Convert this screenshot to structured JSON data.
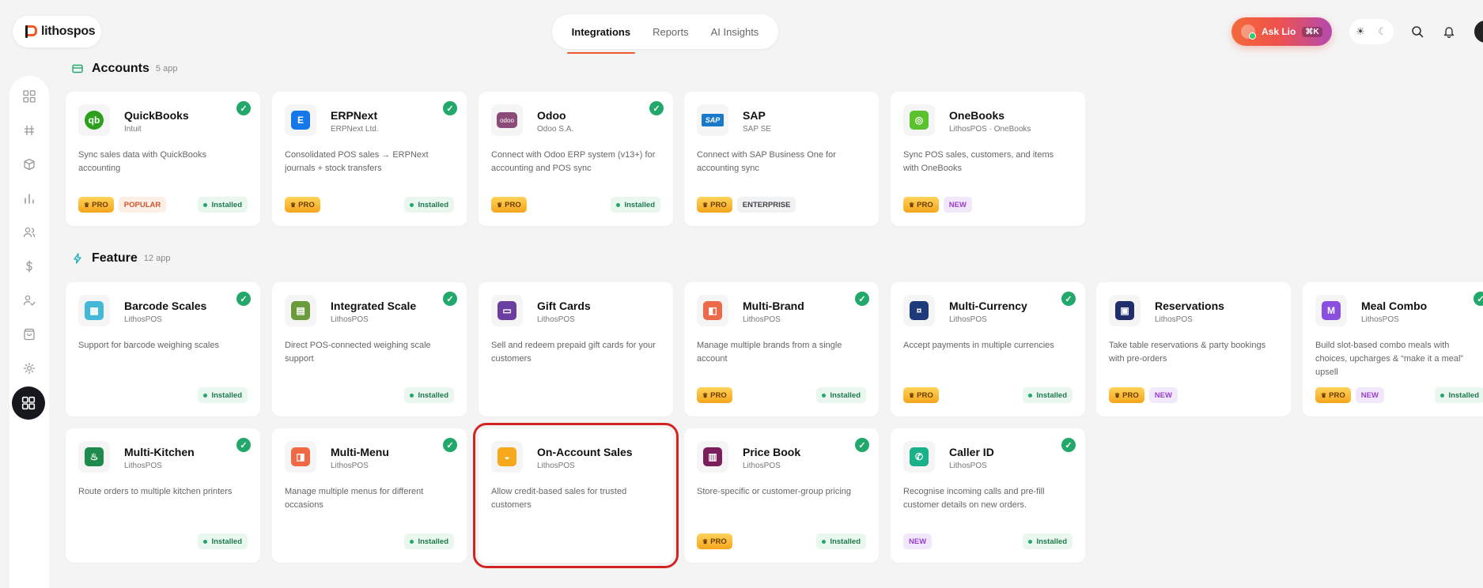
{
  "app": {
    "logo_text": "lithospos"
  },
  "top_tabs": [
    "Integrations",
    "Reports",
    "AI Insights"
  ],
  "ask_lio": {
    "label": "Ask Lio",
    "shortcut": "⌘K"
  },
  "badges": {
    "pro": "PRO",
    "popular": "POPULAR",
    "enterprise": "ENTERPRISE",
    "new": "NEW",
    "installed": "Installed"
  },
  "sections": [
    {
      "title": "Accounts",
      "count": "5 app",
      "cards": [
        {
          "name": "QuickBooks",
          "vendor": "Intuit",
          "desc": "Sync sales data with QuickBooks accounting",
          "icon": "quickbooks-icon",
          "color": "#2ca01c",
          "glyph": "qb",
          "installed_check": true,
          "badges": [
            "pro",
            "popular"
          ],
          "installed": true
        },
        {
          "name": "ERPNext",
          "vendor": "ERPNext Ltd.",
          "desc": "Consolidated POS sales → ERPNext journals + stock transfers",
          "icon": "erpnext-icon",
          "color": "#1677e8",
          "glyph": "E",
          "installed_check": true,
          "badges": [
            "pro"
          ],
          "installed": true
        },
        {
          "name": "Odoo",
          "vendor": "Odoo S.A.",
          "desc": "Connect with Odoo ERP system (v13+) for accounting and POS sync",
          "icon": "odoo-icon",
          "color": "#8a4b78",
          "glyph": "odoo",
          "installed_check": true,
          "badges": [
            "pro"
          ],
          "installed": true
        },
        {
          "name": "SAP",
          "vendor": "SAP SE",
          "desc": "Connect with SAP Business One for accounting sync",
          "icon": "sap-icon",
          "color": "#1b79c9",
          "glyph": "SAP",
          "installed_check": false,
          "badges": [
            "pro",
            "enterprise"
          ],
          "installed": false
        },
        {
          "name": "OneBooks",
          "vendor": "LithosPOS · OneBooks",
          "desc": "Sync POS sales, customers, and items with OneBooks",
          "icon": "onebooks-icon",
          "color": "#5cc12e",
          "glyph": "◎",
          "installed_check": false,
          "badges": [
            "pro",
            "new"
          ],
          "installed": false
        }
      ]
    },
    {
      "title": "Feature",
      "count": "12 app",
      "cards": [
        {
          "name": "Barcode Scales",
          "vendor": "LithosPOS",
          "desc": "Support for barcode weighing scales",
          "icon": "barcode-scale-icon",
          "color": "#45b8d8",
          "glyph": "▦",
          "installed_check": true,
          "badges": [],
          "installed": true
        },
        {
          "name": "Integrated Scale",
          "vendor": "LithosPOS",
          "desc": "Direct POS-connected weighing scale support",
          "icon": "integrated-scale-icon",
          "color": "#6a9c3c",
          "glyph": "▤",
          "installed_check": true,
          "badges": [],
          "installed": true
        },
        {
          "name": "Gift Cards",
          "vendor": "LithosPOS",
          "desc": "Sell and redeem prepaid gift cards for your customers",
          "icon": "gift-card-icon",
          "color": "#6b3fa0",
          "glyph": "▭",
          "installed_check": false,
          "badges": [],
          "installed": false
        },
        {
          "name": "Multi-Brand",
          "vendor": "LithosPOS",
          "desc": "Manage multiple brands from a single account",
          "icon": "multi-brand-icon",
          "color": "#ec6a4a",
          "glyph": "◧",
          "installed_check": true,
          "badges": [
            "pro"
          ],
          "installed": true
        },
        {
          "name": "Multi-Currency",
          "vendor": "LithosPOS",
          "desc": "Accept payments in multiple currencies",
          "icon": "multi-currency-icon",
          "color": "#1f3a7a",
          "glyph": "¤",
          "installed_check": true,
          "badges": [
            "pro"
          ],
          "installed": true
        },
        {
          "name": "Reservations",
          "vendor": "LithosPOS",
          "desc": "Take table reservations & party bookings with pre-orders",
          "icon": "reservations-icon",
          "color": "#1f2f6b",
          "glyph": "▣",
          "installed_check": false,
          "badges": [
            "pro",
            "new"
          ],
          "installed": false
        },
        {
          "name": "Meal Combo",
          "vendor": "LithosPOS",
          "desc": "Build slot-based combo meals with choices, upcharges & “make it a meal” upsell",
          "icon": "meal-combo-icon",
          "color": "#8b4fe0",
          "glyph": "M",
          "installed_check": true,
          "badges": [
            "pro",
            "new"
          ],
          "installed": true
        },
        {
          "name": "Multi-Kitchen",
          "vendor": "LithosPOS",
          "desc": "Route orders to multiple kitchen printers",
          "icon": "multi-kitchen-icon",
          "color": "#1f8a4c",
          "glyph": "♨",
          "installed_check": true,
          "badges": [],
          "installed": true
        },
        {
          "name": "Multi-Menu",
          "vendor": "LithosPOS",
          "desc": "Manage multiple menus for different occasions",
          "icon": "multi-menu-icon",
          "color": "#ef6a44",
          "glyph": "◨",
          "installed_check": true,
          "badges": [],
          "installed": true
        },
        {
          "name": "On-Account Sales",
          "vendor": "LithosPOS",
          "desc": "Allow credit-based sales for trusted customers",
          "icon": "on-account-sales-icon",
          "color": "#f6a91c",
          "glyph": "◒",
          "installed_check": false,
          "badges": [],
          "installed": false,
          "selected": true
        },
        {
          "name": "Price Book",
          "vendor": "LithosPOS",
          "desc": "Store-specific or customer-group pricing",
          "icon": "price-book-icon",
          "color": "#7a1f5c",
          "glyph": "▥",
          "installed_check": true,
          "badges": [
            "pro"
          ],
          "installed": true
        },
        {
          "name": "Caller ID",
          "vendor": "LithosPOS",
          "desc": "Recognise incoming calls and pre-fill customer details on new orders.",
          "icon": "caller-id-icon",
          "color": "#1ab08a",
          "glyph": "✆",
          "installed_check": true,
          "badges": [
            "new"
          ],
          "installed": true
        }
      ]
    }
  ]
}
